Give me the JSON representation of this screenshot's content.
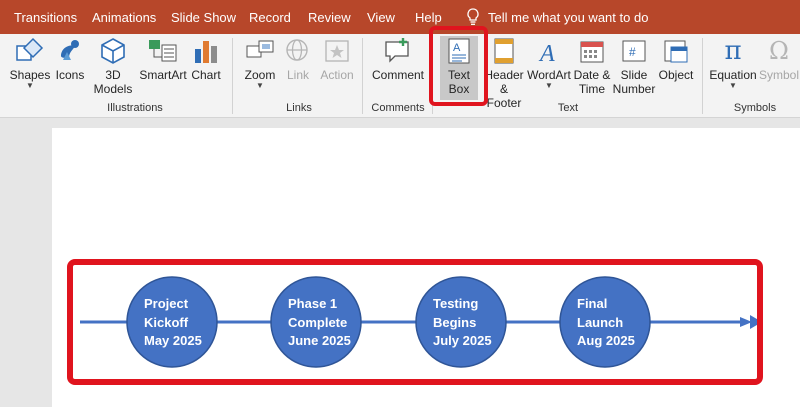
{
  "tabs": [
    "Transitions",
    "Animations",
    "Slide Show",
    "Record",
    "Review",
    "View",
    "Help"
  ],
  "tell_me": "Tell me what you want to do",
  "ribbon": {
    "illustrations": {
      "shapes": "Shapes",
      "icons": "Icons",
      "models_3d_line1": "3D",
      "models_3d_line2": "Models",
      "smartart": "SmartArt",
      "chart": "Chart",
      "label": "Illustrations"
    },
    "links": {
      "zoom": "Zoom",
      "link": "Link",
      "action": "Action",
      "label": "Links"
    },
    "comments": {
      "comment": "Comment",
      "label": "Comments"
    },
    "text": {
      "textbox_line1": "Text",
      "textbox_line2": "Box",
      "header_line1": "Header",
      "header_line2": "& Footer",
      "wordart": "WordArt",
      "datetime_line1": "Date &",
      "datetime_line2": "Time",
      "slidenum_line1": "Slide",
      "slidenum_line2": "Number",
      "object": "Object",
      "label": "Text"
    },
    "symbols": {
      "equation": "Equation",
      "symbol": "Symbol",
      "label": "Symbols",
      "pi_glyph": "π",
      "omega_glyph": "Ω"
    }
  },
  "timeline": {
    "milestones": [
      {
        "line1": "Project",
        "line2": "Kickoff",
        "line3": "May 2025"
      },
      {
        "line1": "Phase 1",
        "line2": "Complete",
        "line3": "June 2025"
      },
      {
        "line1": "Testing",
        "line2": "Begins",
        "line3": "July 2025"
      },
      {
        "line1": "Final",
        "line2": "Launch",
        "line3": "Aug 2025"
      }
    ]
  },
  "colors": {
    "tab_bar": "#b7472a",
    "highlight": "#e0141e",
    "milestone_fill": "#4472c4",
    "arrow": "#4472c4"
  }
}
